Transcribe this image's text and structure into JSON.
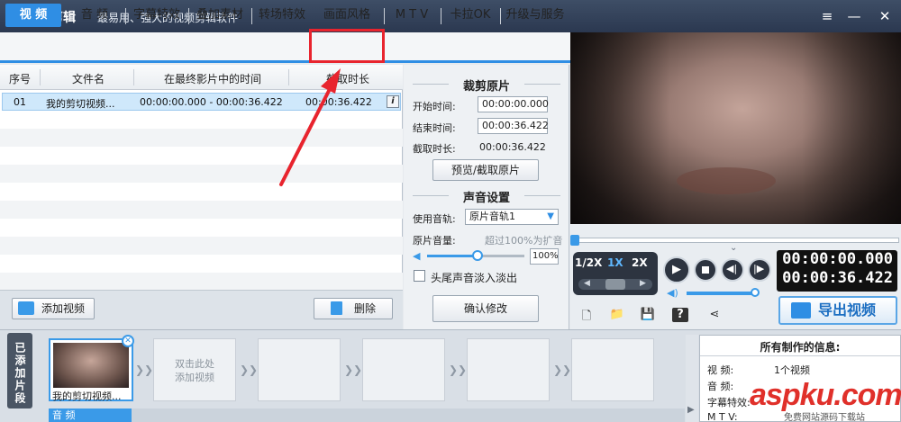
{
  "app": {
    "title": "爱剪辑",
    "slogan": "最易用、强大的视频剪辑软件"
  },
  "window_controls": {
    "menu": "≡",
    "minimize": "—",
    "maximize": "□",
    "close": "✕"
  },
  "tabs": [
    {
      "label": "视 频",
      "active": true
    },
    {
      "label": "音 频"
    },
    {
      "label": "字幕特效"
    },
    {
      "label": "叠加素材"
    },
    {
      "label": "转场特效"
    },
    {
      "label": "画面风格",
      "highlighted": true
    },
    {
      "label": "M T V"
    },
    {
      "label": "卡拉OK"
    },
    {
      "label": "升级与服务"
    }
  ],
  "file_table": {
    "columns": [
      "序号",
      "文件名",
      "在最终影片中的时间",
      "截取时长"
    ],
    "rows": [
      {
        "index": "01",
        "filename": "我的剪切视频...",
        "time_range": "00:00:00.000 - 00:00:36.422",
        "duration": "00:00:36.422"
      }
    ]
  },
  "bottom_buttons": {
    "add_video": "添加视频",
    "delete": "删除"
  },
  "crop": {
    "title": "裁剪原片",
    "start_label": "开始时间:",
    "start_value": "00:00:00.000",
    "end_label": "结束时间:",
    "end_value": "00:00:36.422",
    "duration_label": "截取时长:",
    "duration_value": "00:00:36.422",
    "preview_button": "预览/截取原片"
  },
  "audio_settings": {
    "title": "声音设置",
    "track_label": "使用音轨:",
    "track_value": "原片音轨1",
    "volume_label": "原片音量:",
    "volume_hint": "超过100%为扩音",
    "volume_value": "100%",
    "volume_fraction": 0.52,
    "fade_label": "头尾声音淡入淡出",
    "fade_checked": false,
    "confirm_button": "确认修改"
  },
  "player": {
    "speeds": [
      "1/2X",
      "1X",
      "2X"
    ],
    "current_time": "00:00:00.000",
    "total_time": "00:00:36.422",
    "export_button": "导出视频"
  },
  "timeline": {
    "added_label": "已添加片段",
    "clip1_name": "我的剪切视频...",
    "empty_hint": "双击此处\n添加视频",
    "audio_label": "音 频"
  },
  "info_panel": {
    "title": "所有制作的信息:",
    "items": [
      {
        "label": "视    频:",
        "value": "1个视频"
      },
      {
        "label": "音    频:",
        "value": ""
      },
      {
        "label": "字幕特效:",
        "value": ""
      },
      {
        "label": "M  T  V:",
        "value": ""
      }
    ]
  },
  "watermark": {
    "text": "aspku.com",
    "subtext": "免费网站源码下载站"
  },
  "colors": {
    "accent": "#2f8ee4",
    "highlight": "#e8242e",
    "titlebar": "#34425a"
  }
}
